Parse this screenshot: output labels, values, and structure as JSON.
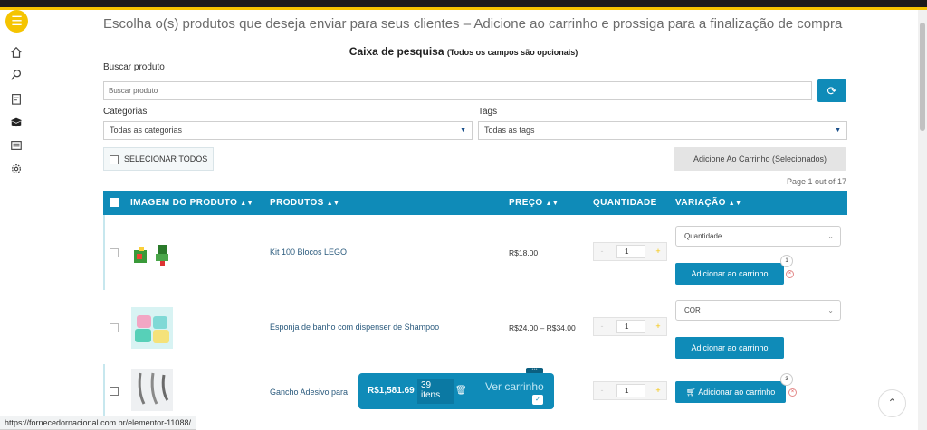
{
  "header": {
    "heading": "Escolha o(s) produtos que deseja enviar para seus clientes – Adicione ao carrinho e prossiga para a finalização de compra"
  },
  "search": {
    "title": "Caixa de pesquisa",
    "subtitle": "(Todos os campos são opcionais)",
    "product_label": "Buscar produto",
    "product_placeholder": "Buscar produto",
    "categories_label": "Categorias",
    "categories_value": "Todas as categorias",
    "tags_label": "Tags",
    "tags_value": "Todas as tags"
  },
  "actions": {
    "select_all": "SELECIONAR TODOS",
    "add_selected": "Adicione Ao Carrinho (Selecionados)",
    "page_info": "Page 1 out of 17"
  },
  "table": {
    "headers": [
      "IMAGEM DO PRODUTO",
      "PRODUTOS",
      "PREÇO",
      "QUANTIDADE",
      "VARIAÇÃO"
    ],
    "rows": [
      {
        "name": "Kit 100 Blocos LEGO",
        "price": "R$18.00",
        "qty": "1",
        "variation": "Quantidade",
        "add_label": "Adicionar ao carrinho",
        "badge": "1"
      },
      {
        "name": "Esponja de banho com dispenser de Shampoo",
        "price": "R$24.00 – R$34.00",
        "qty": "1",
        "variation": "COR",
        "add_label": "Adicionar ao carrinho"
      },
      {
        "name": "Gancho Adesivo para",
        "price": "",
        "qty": "1",
        "add_label": "Adicionar ao carrinho",
        "badge": "3"
      }
    ]
  },
  "cart": {
    "total": "R$1,581.69",
    "items_count": "39",
    "items_word": "itens",
    "view_label": "Ver carrinho"
  },
  "status_url": "https://fornecedornacional.com.br/elementor-11088/",
  "colors": {
    "accent": "#0f8bb8",
    "brand_yellow": "#f5c400"
  },
  "icons": [
    "menu-icon",
    "home-icon",
    "search-icon",
    "clipboard-icon",
    "box-icon",
    "list-icon",
    "gear-icon",
    "refresh-icon",
    "trash-icon",
    "bag-icon",
    "chevron-up-icon"
  ]
}
